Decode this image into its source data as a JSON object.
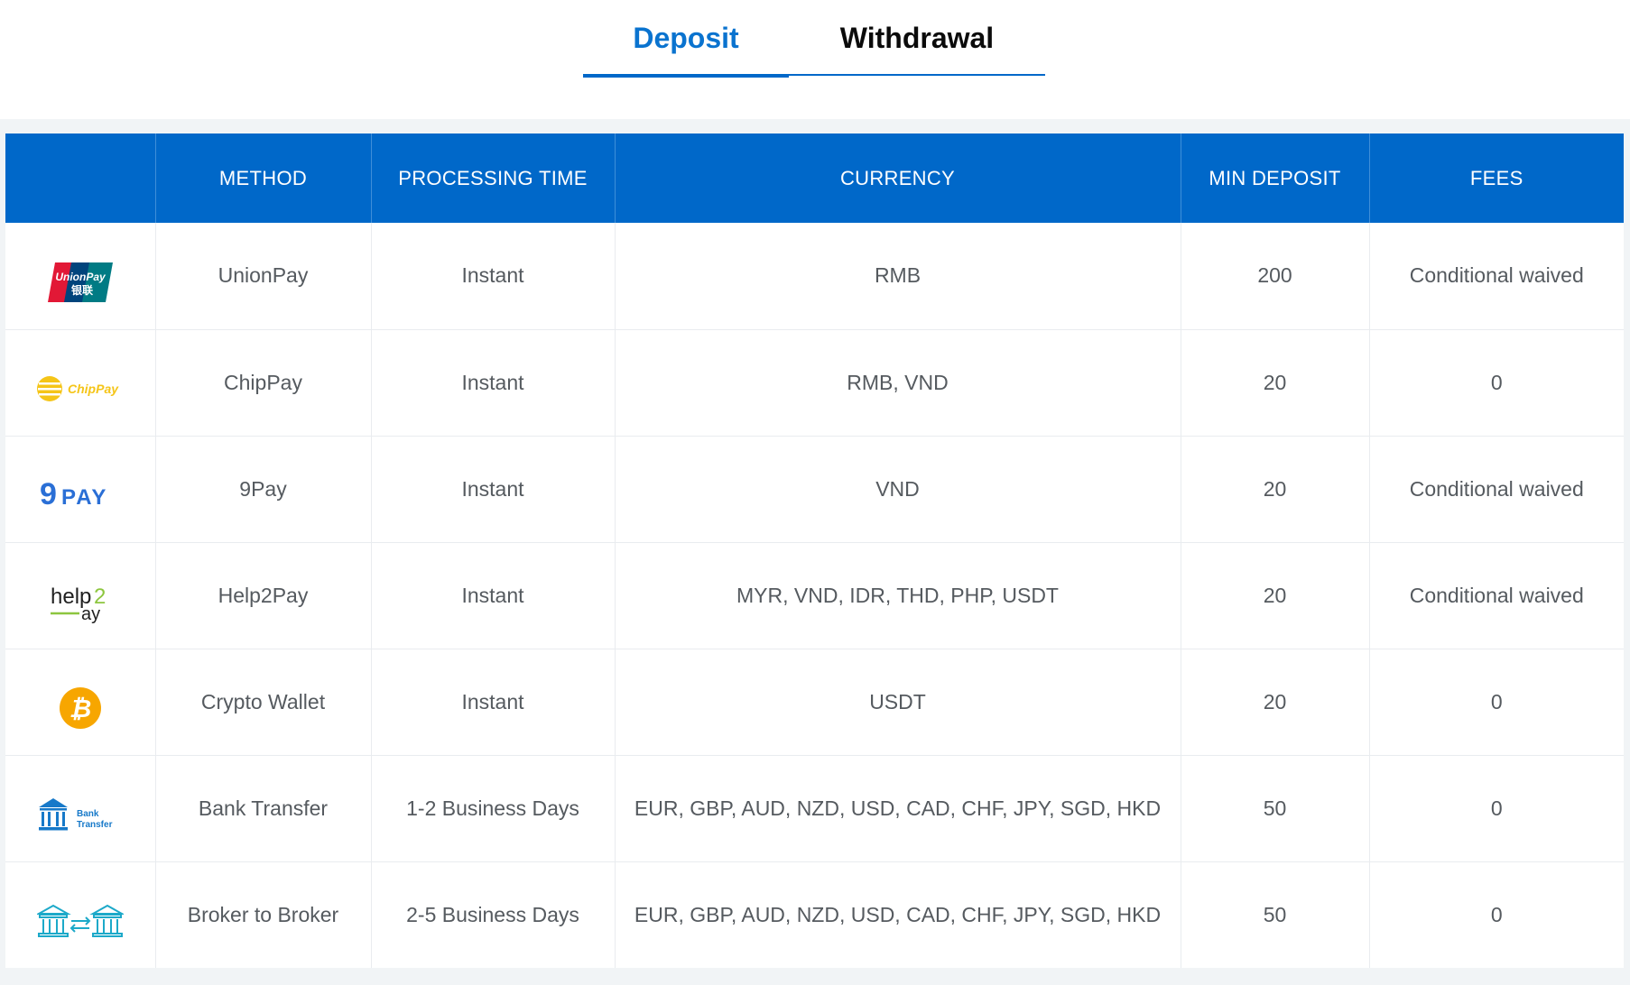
{
  "tabs": {
    "deposit": "Deposit",
    "withdrawal": "Withdrawal",
    "active": "Deposit"
  },
  "table": {
    "headers": [
      "",
      "METHOD",
      "PROCESSING TIME",
      "CURRENCY",
      "MIN DEPOSIT",
      "FEES"
    ],
    "rows": [
      {
        "logo": "unionpay-logo",
        "logo_text": "UnionPay 银联",
        "method": "UnionPay",
        "time": "Instant",
        "currency": "RMB",
        "min": "200",
        "fees": "Conditional waived"
      },
      {
        "logo": "chippay-logo",
        "logo_text": "ChipPay",
        "method": "ChipPay",
        "time": "Instant",
        "currency": "RMB, VND",
        "min": "20",
        "fees": "0"
      },
      {
        "logo": "9pay-logo",
        "logo_text": "9PAY",
        "method": "9Pay",
        "time": "Instant",
        "currency": "VND",
        "min": "20",
        "fees": "Conditional waived"
      },
      {
        "logo": "help2pay-logo",
        "logo_text": "help2pay",
        "method": "Help2Pay",
        "time": "Instant",
        "currency": "MYR, VND, IDR, THD, PHP, USDT",
        "min": "20",
        "fees": "Conditional waived"
      },
      {
        "logo": "bitcoin-icon",
        "logo_text": "",
        "method": "Crypto Wallet",
        "time": "Instant",
        "currency": "USDT",
        "min": "20",
        "fees": "0"
      },
      {
        "logo": "bank-transfer-icon",
        "logo_text": "Bank Transfer",
        "method": "Bank Transfer",
        "time": "1-2 Business Days",
        "currency": "EUR, GBP, AUD, NZD, USD, CAD, CHF, JPY, SGD, HKD",
        "min": "50",
        "fees": "0"
      },
      {
        "logo": "broker-to-broker-icon",
        "logo_text": "",
        "method": "Broker to Broker",
        "time": "2-5 Business Days",
        "currency": "EUR, GBP, AUD, NZD, USD, CAD, CHF, JPY, SGD, HKD",
        "min": "50",
        "fees": "0"
      }
    ]
  },
  "colors": {
    "header_bg": "#0068c9",
    "active_tab": "#0a73cf",
    "text": "#555a5f",
    "unionpay_red": "#e21836",
    "unionpay_blue": "#00447c",
    "unionpay_teal": "#007b84",
    "chippay_yellow": "#f5c518",
    "ninepay_blue": "#2a6fd6",
    "help2pay_green": "#8dc63f",
    "bitcoin_orange": "#f7a600",
    "bank_blue": "#1779c9"
  }
}
